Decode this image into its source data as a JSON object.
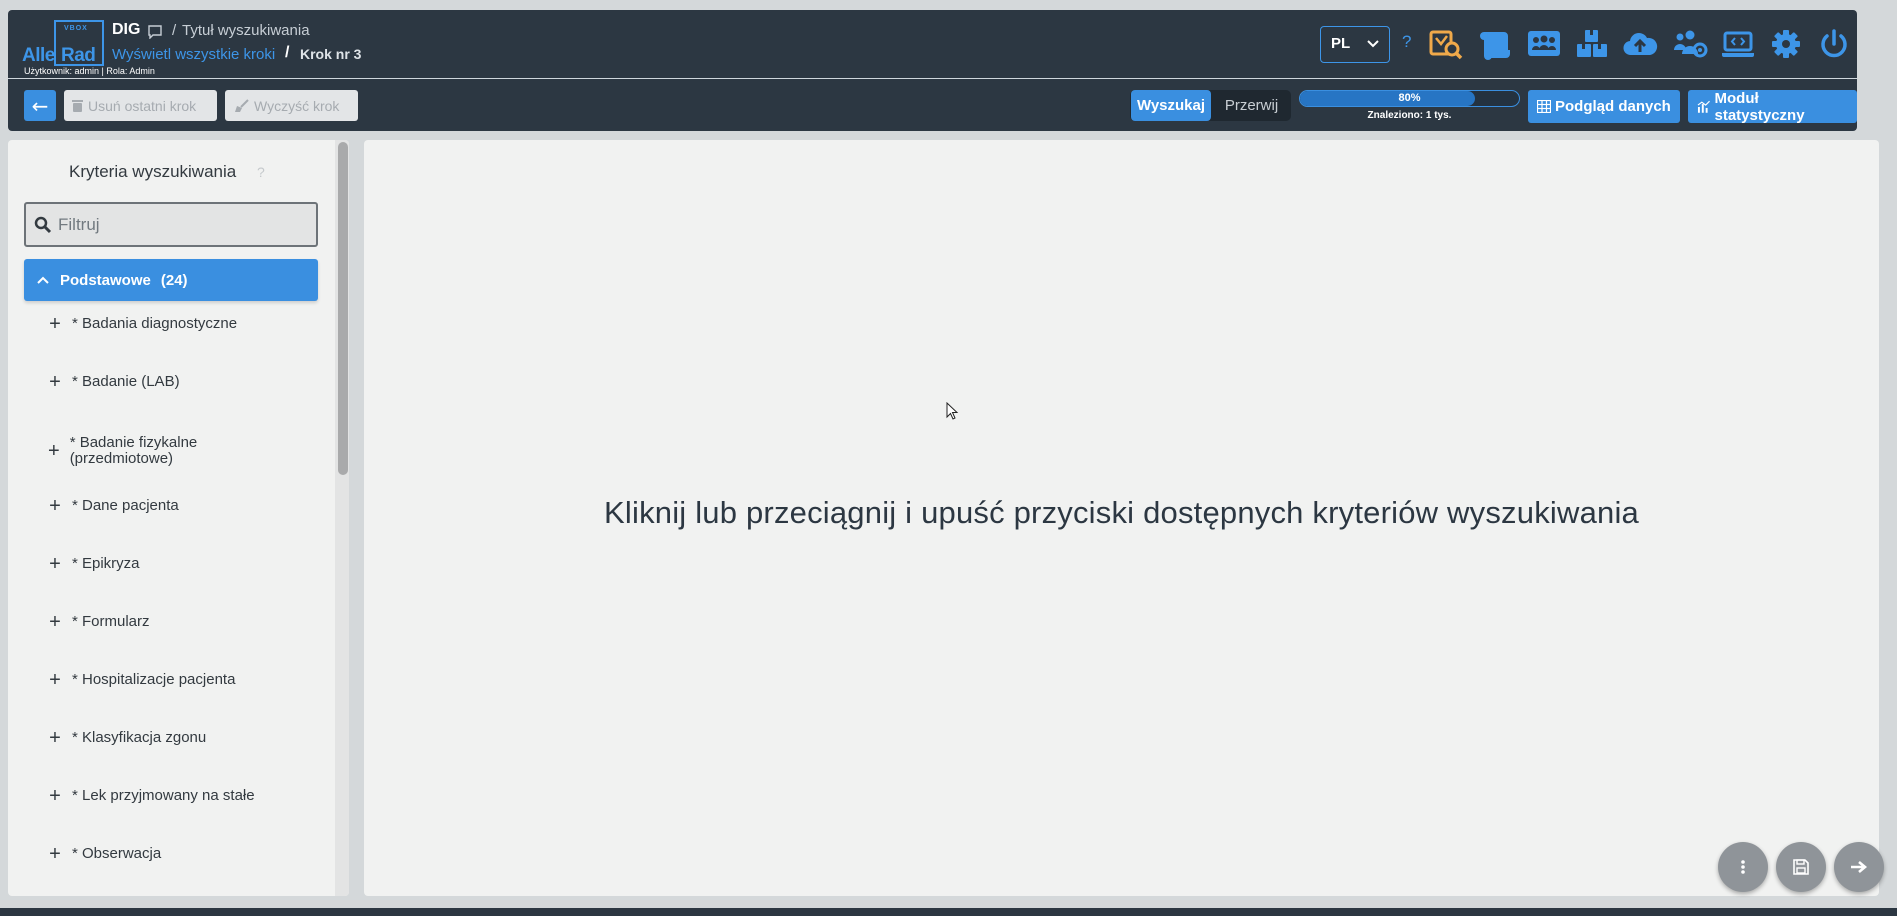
{
  "header": {
    "logo": {
      "line1": "Alle",
      "line2": "Rad",
      "small": "VBOX"
    },
    "app_name": "DIG",
    "title_sep": "/",
    "search_title": "Tytuł wyszukiwania",
    "all_steps_link": "Wyświetl wszystkie kroki",
    "step_sep": "/",
    "current_step": "Krok nr 3",
    "user_info": "Użytkownik: admin | Rola: Admin",
    "language": "PL",
    "help": "?",
    "icons": [
      "search-report-icon",
      "scroll-icon",
      "team-board-icon",
      "boxes-icon",
      "cloud-upload-icon",
      "users-gear-icon",
      "laptop-code-icon",
      "gear-icon",
      "power-icon"
    ]
  },
  "toolbar": {
    "back_label": "←",
    "remove_last_step": "Usuń ostatni krok",
    "clear_step": "Wyczyść krok",
    "search_label": "Wyszukaj",
    "stop_label": "Przerwij",
    "progress_percent": 80,
    "progress_text": "80%",
    "found_text": "Znaleziono: 1 tys.",
    "data_preview": "Podgląd danych",
    "stat_module": "Moduł statystyczny"
  },
  "sidebar": {
    "title": "Kryteria wyszukiwania",
    "help": "?",
    "filter_placeholder": "Filtruj",
    "filter_value": "",
    "group": {
      "label": "Podstawowe",
      "count": "(24)"
    },
    "items": [
      "* Badania diagnostyczne",
      "* Badanie (LAB)",
      "* Badanie fizykalne (przedmiotowe)",
      "* Dane pacjenta",
      "* Epikryza",
      "* Formularz",
      "* Hospitalizacje pacjenta",
      "* Klasyfikacja zgonu",
      "* Lek przyjmowany na stałe",
      "* Obserwacja"
    ]
  },
  "main": {
    "drop_hint": "Kliknij lub przeciągnij i upuść przyciski dostępnych kryteriów wyszukiwania"
  },
  "colors": {
    "header_bg": "#2c3742",
    "accent": "#3a8fe0",
    "orange_icon": "#f0a94a",
    "panel_bg": "#f1f2f1"
  }
}
